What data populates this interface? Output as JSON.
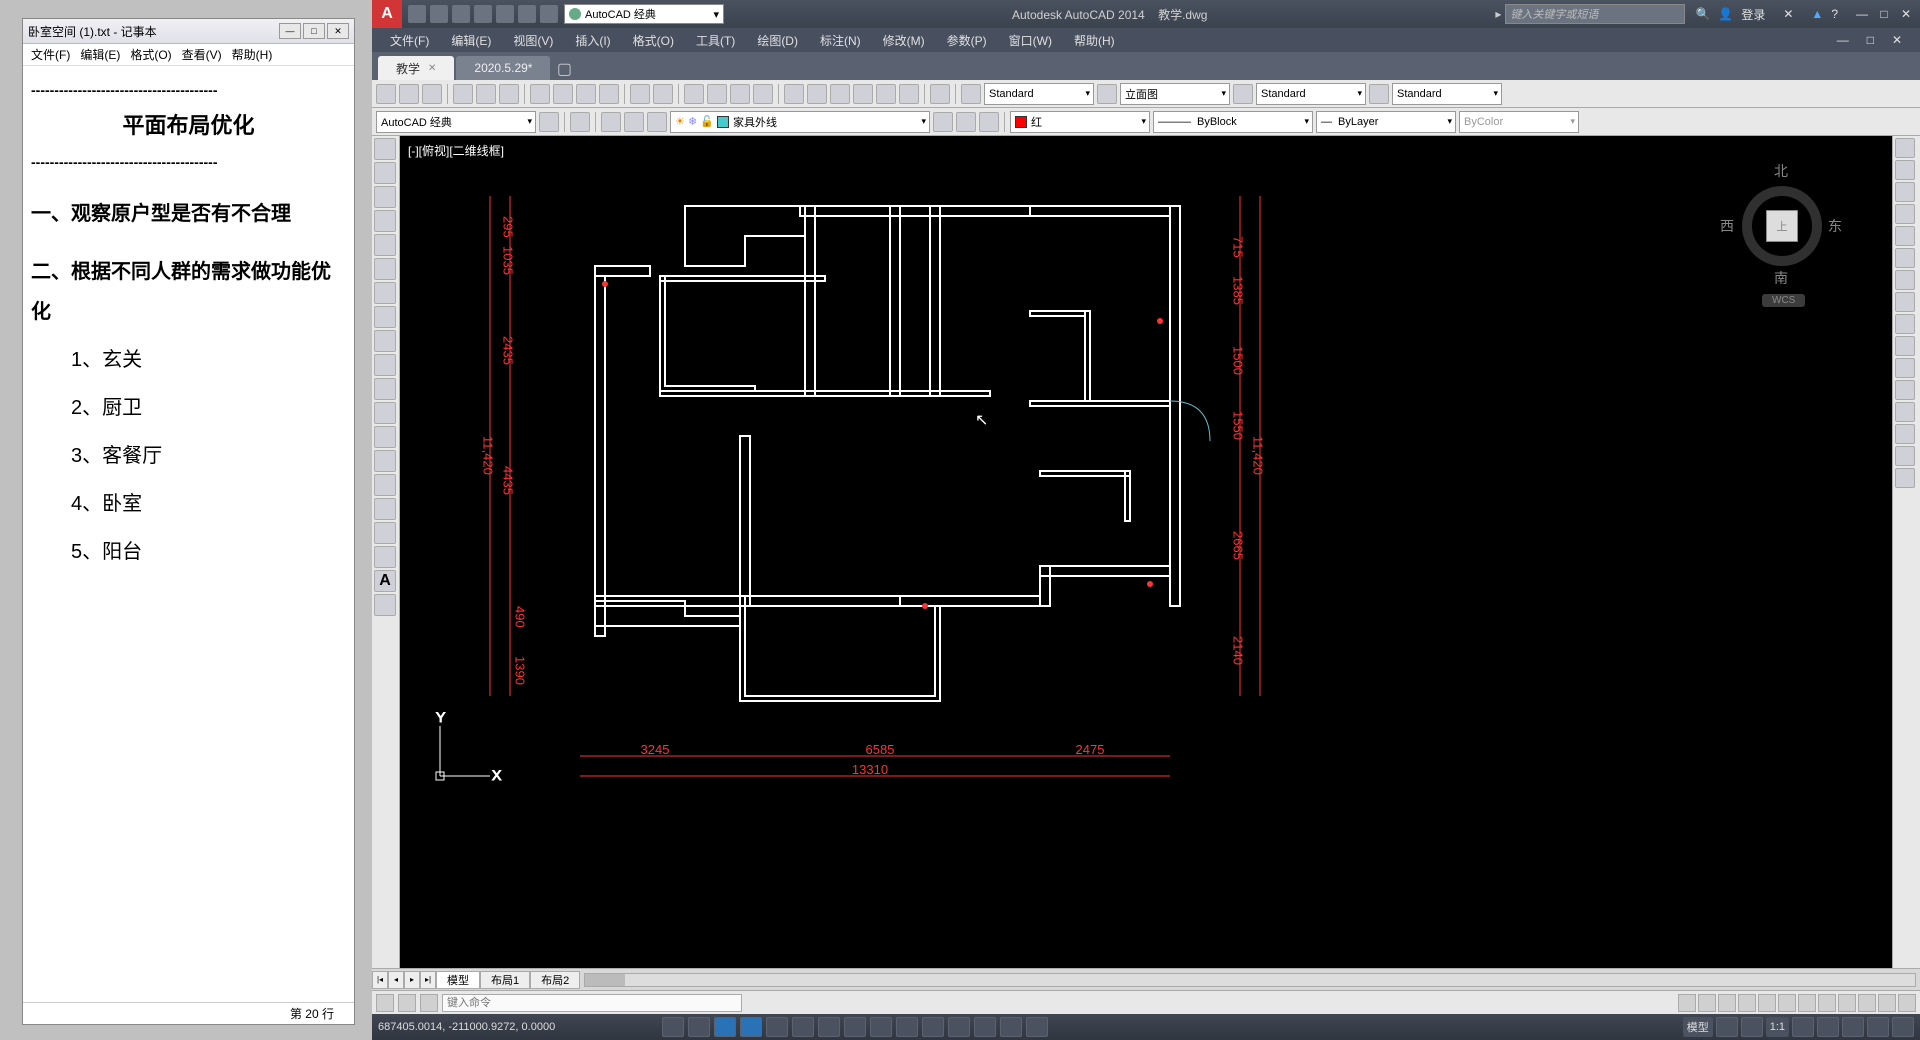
{
  "notepad": {
    "title": "卧室空间 (1).txt - 记事本",
    "menu": [
      "文件(F)",
      "编辑(E)",
      "格式(O)",
      "查看(V)",
      "帮助(H)"
    ],
    "dashline": "----------------------------------------",
    "heading": "平面布局优化",
    "sec1": "一、观察原户型是否有不合理",
    "sec2": "二、根据不同人群的需求做功能优化",
    "items": [
      "1、玄关",
      "2、厨卫",
      "3、客餐厅",
      "4、卧室",
      "5、阳台"
    ],
    "status": "第 20 行"
  },
  "acad": {
    "app_title": "Autodesk AutoCAD 2014",
    "doc_title": "教学.dwg",
    "workspace_qat": "AutoCAD 经典",
    "search_placeholder": "键入关键字或短语",
    "login": "登录",
    "menu": [
      "文件(F)",
      "编辑(E)",
      "视图(V)",
      "插入(I)",
      "格式(O)",
      "工具(T)",
      "绘图(D)",
      "标注(N)",
      "修改(M)",
      "参数(P)",
      "窗口(W)",
      "帮助(H)"
    ],
    "tabs": [
      {
        "label": "教学",
        "active": true
      },
      {
        "label": "2020.5.29*",
        "active": false
      }
    ],
    "style1": "Standard",
    "style2": "立面图",
    "style3": "Standard",
    "style4": "Standard",
    "workspace2": "AutoCAD 经典",
    "layer": "家具外线",
    "color": "红",
    "linetype": "ByBlock",
    "lineweight": "ByLayer",
    "plotstyle": "ByColor",
    "viewport_label": "[-][俯视][二维线框]",
    "viewcube": {
      "n": "北",
      "s": "南",
      "w": "西",
      "e": "东",
      "top": "上",
      "wcs": "WCS"
    },
    "dimensions": {
      "left": [
        "295",
        "1035",
        "2435",
        "11,420",
        "4435",
        "490",
        "1390"
      ],
      "right": [
        "715",
        "1385",
        "1500",
        "1550",
        "11,420",
        "2665",
        "2140"
      ],
      "bottom": [
        "3245",
        "6585",
        "2475",
        "13310"
      ]
    },
    "ucs": {
      "x": "X",
      "y": "Y"
    },
    "layouts": {
      "nav": [
        "|◂",
        "◂",
        "▸",
        "▸|"
      ],
      "tabs": [
        "模型",
        "布局1",
        "布局2"
      ]
    },
    "cmd_placeholder": "键入命令",
    "coords": "687405.0014, -211000.9272, 0.0000",
    "status_right": [
      "模型",
      "1:1",
      "□"
    ]
  }
}
